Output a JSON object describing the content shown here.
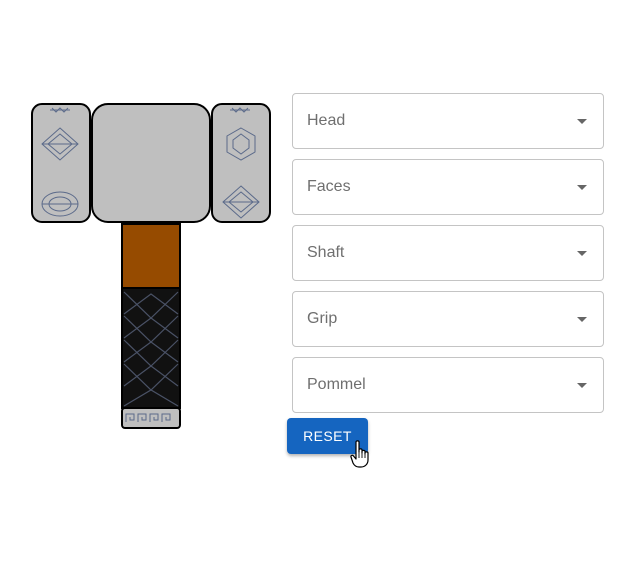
{
  "selects": [
    {
      "label": "Head"
    },
    {
      "label": "Faces"
    },
    {
      "label": "Shaft"
    },
    {
      "label": "Grip"
    },
    {
      "label": "Pommel"
    }
  ],
  "reset_label": "RESET",
  "colors": {
    "head": "#bfbfbf",
    "shaft": "#964b00",
    "grip": "#111111",
    "button": "#1565c0",
    "engraving": "#5b6a8a"
  }
}
